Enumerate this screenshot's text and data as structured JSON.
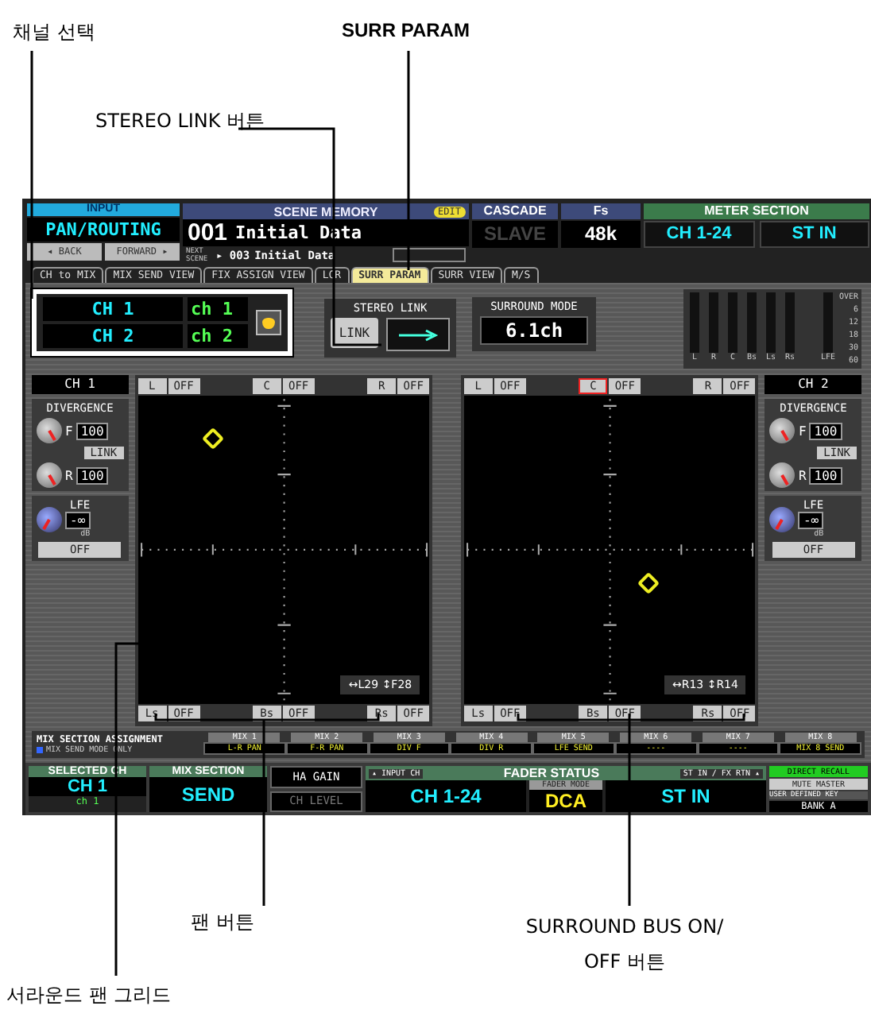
{
  "annotations": [
    {
      "text": "채널 선택",
      "kind": "label"
    },
    {
      "text": "SURR PARAM",
      "kind": "title"
    },
    {
      "text": "STEREO LINK 버튼",
      "kind": "label"
    },
    {
      "text": "팬 버튼",
      "kind": "label"
    },
    {
      "text": "SURROUND BUS ON/ OFF 버튼",
      "kind": "label"
    },
    {
      "text": "서라운드 팬 그리드",
      "kind": "label"
    }
  ],
  "header": {
    "input_label": "INPUT",
    "function": "PAN/ROUTING",
    "back": "◂ BACK",
    "forward": "FORWARD ▸",
    "scene_memory": {
      "title": "SCENE MEMORY",
      "number": "001",
      "name": "Initial Data",
      "edit": "EDIT",
      "next_label": "NEXT SCENE",
      "next_number": "▸ 003",
      "next_name": "Initial Data"
    },
    "cascade": {
      "title": "CASCADE",
      "value": "SLAVE"
    },
    "fs": {
      "title": "Fs",
      "value": "48k"
    },
    "meter_section": {
      "title": "METER SECTION",
      "values": [
        "CH 1-24",
        "ST IN"
      ]
    }
  },
  "tabs": [
    {
      "label": "CH to MIX",
      "selected": false
    },
    {
      "label": "MIX SEND VIEW",
      "selected": false
    },
    {
      "label": "FIX ASSIGN VIEW",
      "selected": false
    },
    {
      "label": "LCR",
      "selected": false
    },
    {
      "label": "SURR PARAM",
      "selected": true
    },
    {
      "label": "SURR VIEW",
      "selected": false
    },
    {
      "label": "M/S",
      "selected": false
    }
  ],
  "channel_select": [
    {
      "channel": "CH 1",
      "name": "ch 1"
    },
    {
      "channel": "CH 2",
      "name": "ch 2"
    }
  ],
  "stereo_link": {
    "title": "STEREO LINK",
    "button": "LINK",
    "on": false
  },
  "surround_mode": {
    "title": "SURROUND MODE",
    "value": "6.1ch"
  },
  "meters": {
    "labels": [
      "L",
      "R",
      "C",
      "Bs",
      "Ls",
      "Rs",
      "LFE"
    ],
    "scale": [
      "OVER",
      "6",
      "12",
      "18",
      "30",
      "60"
    ]
  },
  "channels": [
    {
      "name": "CH 1",
      "divergence_title": "DIVERGENCE",
      "front": {
        "label": "F",
        "value": "100"
      },
      "link": "LINK",
      "rear": {
        "label": "R",
        "value": "100"
      },
      "lfe": {
        "title": "LFE",
        "value": "-∞",
        "unit": "dB"
      },
      "off": "OFF",
      "top_buses": [
        {
          "label": "L",
          "state": "OFF",
          "selected": false
        },
        {
          "label": "C",
          "state": "OFF",
          "selected": false
        },
        {
          "label": "R",
          "state": "OFF",
          "selected": false
        }
      ],
      "bottom_buses": [
        {
          "label": "Ls",
          "state": "OFF",
          "selected": false
        },
        {
          "label": "Bs",
          "state": "OFF",
          "selected": false
        },
        {
          "label": "Rs",
          "state": "OFF",
          "selected": false
        }
      ],
      "readout": "↔L29 ↕F28"
    },
    {
      "name": "CH 2",
      "divergence_title": "DIVERGENCE",
      "front": {
        "label": "F",
        "value": "100"
      },
      "link": "LINK",
      "rear": {
        "label": "R",
        "value": "100"
      },
      "lfe": {
        "title": "LFE",
        "value": "-∞",
        "unit": "dB"
      },
      "off": "OFF",
      "top_buses": [
        {
          "label": "L",
          "state": "OFF",
          "selected": false
        },
        {
          "label": "C",
          "state": "OFF",
          "selected": true
        },
        {
          "label": "R",
          "state": "OFF",
          "selected": false
        }
      ],
      "bottom_buses": [
        {
          "label": "Ls",
          "state": "OFF",
          "selected": false
        },
        {
          "label": "Bs",
          "state": "OFF",
          "selected": false
        },
        {
          "label": "Rs",
          "state": "OFF",
          "selected": false
        }
      ],
      "readout": "↔R13 ↕R14"
    }
  ],
  "mix_assignment": {
    "title": "MIX SECTION ASSIGNMENT",
    "note": "MIX SEND MODE ONLY",
    "slots": [
      {
        "mix": "MIX 1",
        "value": "L-R PAN"
      },
      {
        "mix": "MIX 2",
        "value": "F-R PAN"
      },
      {
        "mix": "MIX 3",
        "value": "DIV F"
      },
      {
        "mix": "MIX 4",
        "value": "DIV R"
      },
      {
        "mix": "MIX 5",
        "value": "LFE SEND"
      },
      {
        "mix": "MIX 6",
        "value": "----"
      },
      {
        "mix": "MIX 7",
        "value": "----"
      },
      {
        "mix": "MIX 8",
        "value": "MIX 8 SEND"
      }
    ]
  },
  "footer": {
    "selected_ch": {
      "title": "SELECTED CH",
      "value": "CH 1",
      "name": "ch 1"
    },
    "mix_section": {
      "title": "MIX SECTION",
      "value": "SEND"
    },
    "encoder_modes": [
      {
        "label": "HA GAIN",
        "selected": true
      },
      {
        "label": "CH LEVEL",
        "selected": false
      }
    ],
    "fader_status": {
      "title": "FADER STATUS",
      "input_label": "▴ INPUT CH",
      "input_value": "CH 1-24",
      "mode_label": "FADER MODE",
      "mode_value": "DCA",
      "st_label": "ST IN / FX RTN ▴",
      "st_value": "ST IN"
    },
    "keys": {
      "direct_recall": "DIRECT RECALL",
      "mute_master": "MUTE MASTER",
      "user_keys": "USER DEFINED KEY",
      "bank": "BANK A"
    }
  }
}
